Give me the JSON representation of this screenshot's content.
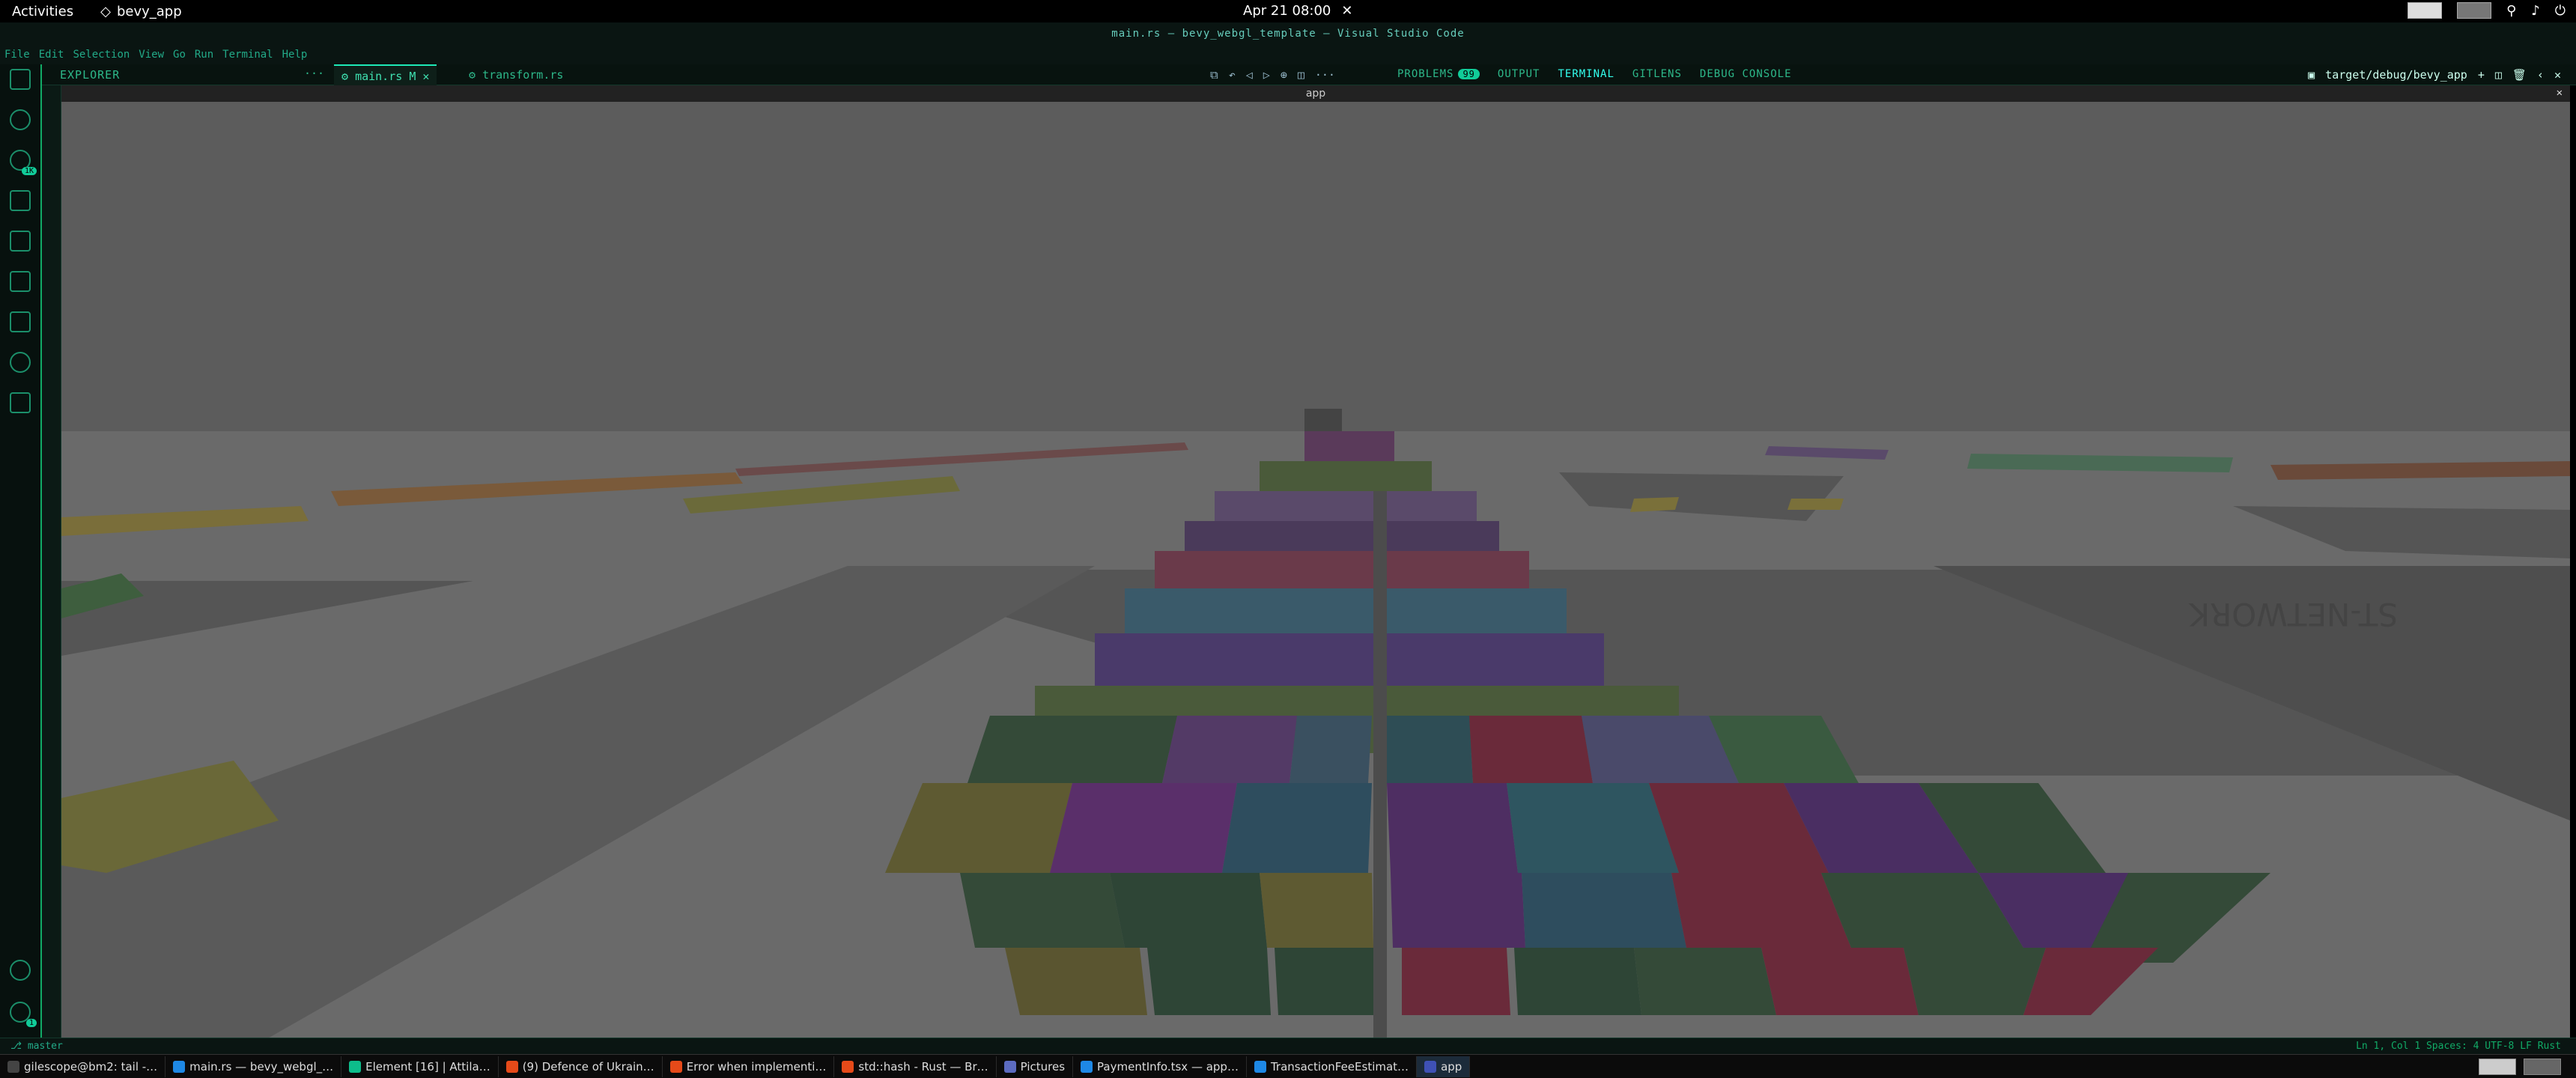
{
  "topbar": {
    "activities": "Activities",
    "app_name": "bevy_app",
    "clock": "Apr 21  08:00"
  },
  "window_title": "main.rs — bevy_webgl_template — Visual Studio Code",
  "menu": [
    "File",
    "Edit",
    "Selection",
    "View",
    "Go",
    "Run",
    "Terminal",
    "Help"
  ],
  "activity_badges": {
    "source_control": "1K",
    "accounts": "1"
  },
  "explorer_label": "EXPLORER",
  "editor_tabs": [
    {
      "label": "main.rs",
      "modified": "M"
    },
    {
      "label": "transform.rs"
    }
  ],
  "panel_tabs": {
    "problems": "PROBLEMS",
    "problems_count": "99",
    "output": "OUTPUT",
    "terminal": "TERMINAL",
    "gitlens": "GITLENS",
    "debug_console": "DEBUG CONSOLE"
  },
  "terminal_name": "target/debug/bevy_app",
  "app_window_title": "app",
  "scene_texts": {
    "network_label": "ST-NETWORK"
  },
  "statusbar": {
    "branch": "master",
    "right": "Ln 1, Col 1   Spaces: 4   UTF-8   LF   Rust"
  },
  "taskbar": [
    {
      "label": "gilescope@bm2: tail -…",
      "color": "#444444"
    },
    {
      "label": "main.rs — bevy_webgl_…",
      "color": "#1e88e5"
    },
    {
      "label": "Element [16] | Attila…",
      "color": "#0dbd8b"
    },
    {
      "label": "(9) Defence of Ukrain…",
      "color": "#e64a19"
    },
    {
      "label": "Error when implementi…",
      "color": "#e64a19"
    },
    {
      "label": "std::hash - Rust — Br…",
      "color": "#e64a19"
    },
    {
      "label": "Pictures",
      "color": "#5c6bc0"
    },
    {
      "label": "PaymentInfo.tsx — app…",
      "color": "#1e88e5"
    },
    {
      "label": "TransactionFeeEstimat…",
      "color": "#1e88e5"
    },
    {
      "label": "app",
      "color": "#3f51b5",
      "active": true
    }
  ]
}
